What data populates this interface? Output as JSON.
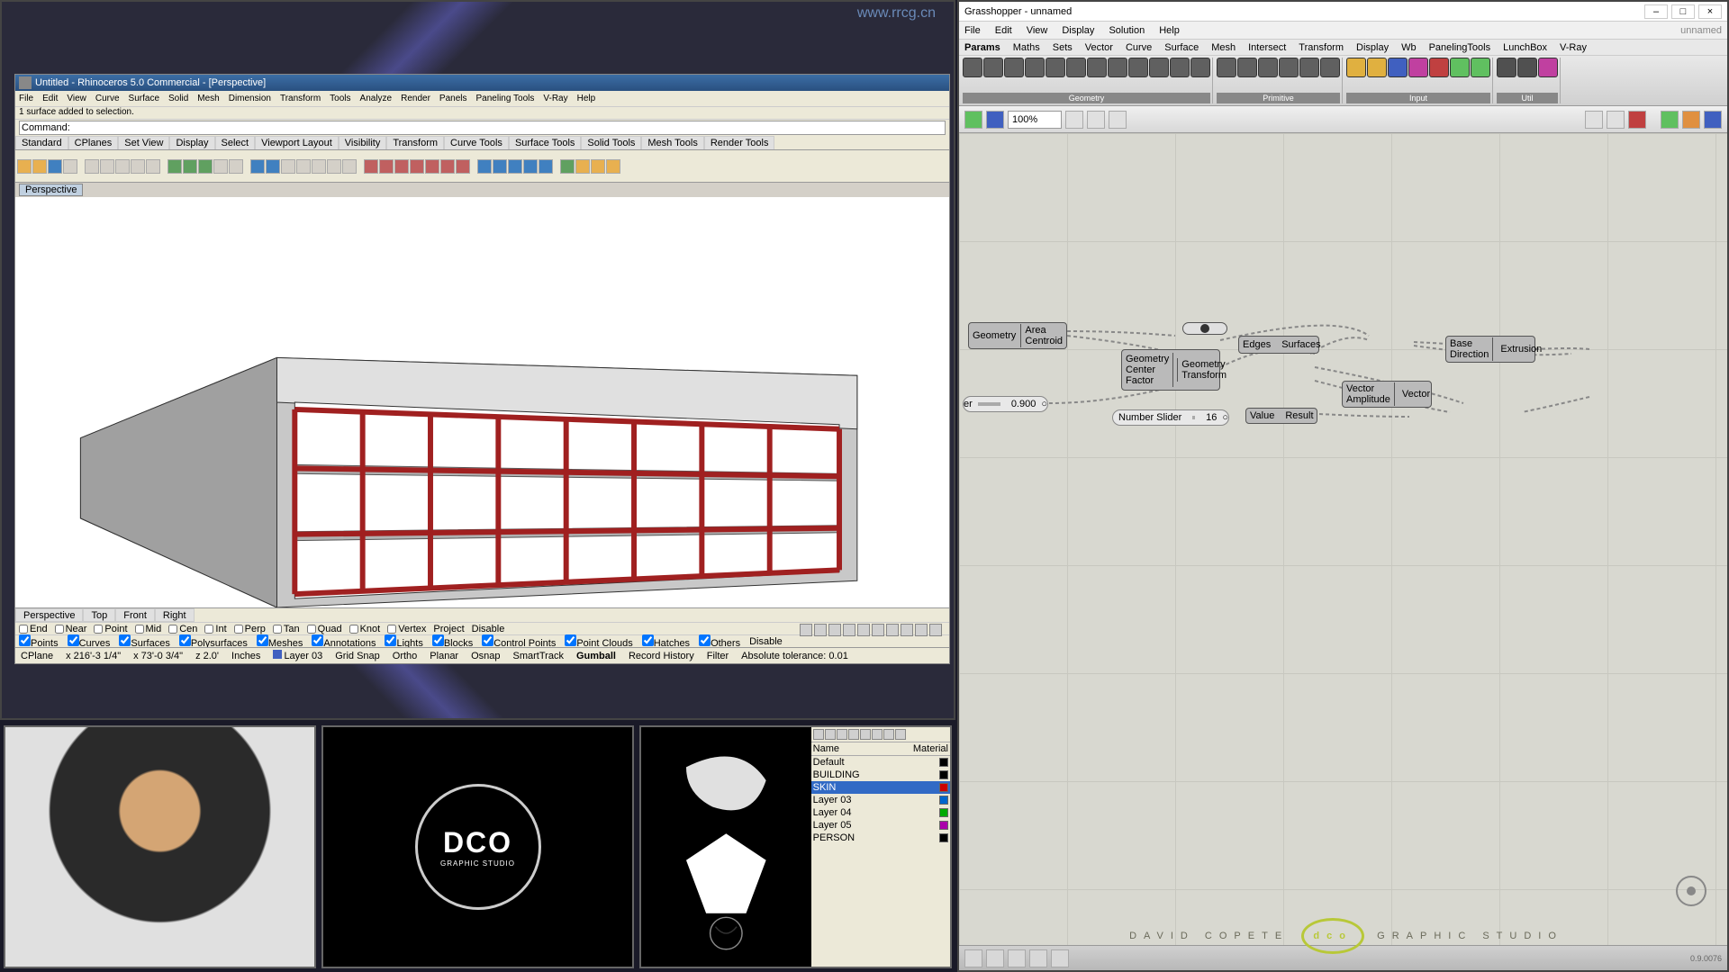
{
  "watermark": "www.rrcg.cn",
  "rhino": {
    "title": "Untitled - Rhinoceros 5.0 Commercial - [Perspective]",
    "menu": [
      "File",
      "Edit",
      "View",
      "Curve",
      "Surface",
      "Solid",
      "Mesh",
      "Dimension",
      "Transform",
      "Tools",
      "Analyze",
      "Render",
      "Panels",
      "Paneling Tools",
      "V-Ray",
      "Help"
    ],
    "status_msg": "1 surface added to selection.",
    "command_label": "Command:",
    "tool_tabs": [
      "Standard",
      "CPlanes",
      "Set View",
      "Display",
      "Select",
      "Viewport Layout",
      "Visibility",
      "Transform",
      "Curve Tools",
      "Surface Tools",
      "Solid Tools",
      "Mesh Tools",
      "Render Tools"
    ],
    "viewport_tab": "Perspective",
    "bottom_tabs": [
      "Perspective",
      "Top",
      "Front",
      "Right"
    ],
    "osnaps": [
      "End",
      "Near",
      "Point",
      "Mid",
      "Cen",
      "Int",
      "Perp",
      "Tan",
      "Quad",
      "Knot",
      "Vertex"
    ],
    "osnap_extra": [
      "Project",
      "Disable"
    ],
    "filters": [
      "Points",
      "Curves",
      "Surfaces",
      "Polysurfaces",
      "Meshes",
      "Annotations",
      "Lights",
      "Blocks",
      "Control Points",
      "Point Clouds",
      "Hatches",
      "Others"
    ],
    "filter_disable": "Disable",
    "statusbar": {
      "cplane": "CPlane",
      "x": "x 216'-3 1/4\"",
      "y": "x 73'-0 3/4\"",
      "z": "z 2.0'",
      "units": "Inches",
      "layer": "Layer 03",
      "items": [
        "Grid Snap",
        "Ortho",
        "Planar",
        "Osnap",
        "SmartTrack",
        "Gumball",
        "Record History",
        "Filter"
      ],
      "tol": "Absolute tolerance: 0.01"
    }
  },
  "grasshopper": {
    "title": "Grasshopper - unnamed",
    "doc_name": "unnamed",
    "menu": [
      "File",
      "Edit",
      "View",
      "Display",
      "Solution",
      "Help"
    ],
    "ribbon_tabs": [
      "Params",
      "Maths",
      "Sets",
      "Vector",
      "Curve",
      "Surface",
      "Mesh",
      "Intersect",
      "Transform",
      "Display",
      "Wb",
      "PanelingTools",
      "LunchBox",
      "V-Ray"
    ],
    "ribbon_groups": [
      "Geometry",
      "Primitive",
      "Input",
      "Util"
    ],
    "zoom": "100%",
    "version": "0.9.0076",
    "nodes": {
      "area": {
        "in": "Geometry",
        "out1": "Area",
        "out2": "Centroid"
      },
      "scale": {
        "in1": "Geometry",
        "in2": "Center",
        "in3": "Factor",
        "out1": "Geometry",
        "out2": "Transform"
      },
      "brep": {
        "out1": "Edges",
        "out2": "Surfaces"
      },
      "extrude": {
        "in1": "Base",
        "in2": "Direction",
        "out": "Extrusion"
      },
      "amp": {
        "in1": "Vector",
        "in2": "Amplitude",
        "out": "Vector"
      },
      "eval": {
        "in": "Value",
        "out": "Result"
      },
      "slider1": {
        "val": "0.900"
      },
      "slider2": {
        "label": "Number Slider",
        "val": "16"
      }
    }
  },
  "layers": {
    "header_cols": [
      "Name",
      "",
      "",
      "Material"
    ],
    "rows": [
      {
        "name": "Default",
        "sel": false,
        "c": "k"
      },
      {
        "name": "BUILDING",
        "sel": false,
        "c": "k"
      },
      {
        "name": "SKIN",
        "sel": true,
        "c": "r"
      },
      {
        "name": "Layer 03",
        "sel": false,
        "c": "b"
      },
      {
        "name": "Layer 04",
        "sel": false,
        "c": "g"
      },
      {
        "name": "Layer 05",
        "sel": false,
        "c": "m"
      },
      {
        "name": "PERSON",
        "sel": false,
        "c": "k"
      }
    ]
  },
  "dco": {
    "big": "DCO",
    "sm": "GRAPHIC STUDIO"
  },
  "footer": {
    "text_left": "DAVID COPETE",
    "text_right": "GRAPHIC STUDIO",
    "logo": "dco"
  }
}
